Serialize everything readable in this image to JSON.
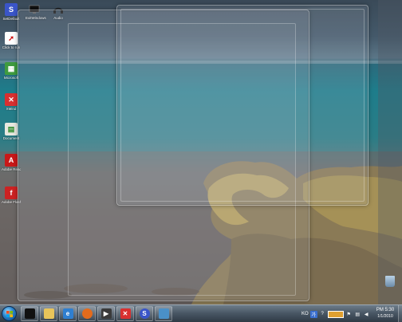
{
  "desktop": {
    "top_icons": [
      {
        "label": "ExitWindows",
        "icon": "monitor-icon"
      },
      {
        "label": "Audio",
        "icon": "headphones-icon"
      }
    ],
    "left_icons": [
      {
        "label": "SetDefault",
        "icon": "swirl-app-icon",
        "color": "#3a55c8"
      },
      {
        "label": "Click to run",
        "icon": "cursor-app-icon",
        "color": "#ffffff"
      },
      {
        "label": "Microsoft",
        "icon": "sheet-app-icon",
        "color": "#3f9b3f"
      },
      {
        "label": "XMind",
        "icon": "x-app-icon",
        "color": "#d83030"
      },
      {
        "label": "Document",
        "icon": "document-icon",
        "color": "#e8e8e0"
      },
      {
        "label": "Adobe Reader",
        "icon": "pdf-icon",
        "color": "#c81818"
      },
      {
        "label": "Adobe Flash",
        "icon": "flash-icon",
        "color": "#cc2222"
      }
    ],
    "recycle_bin": {
      "label": "",
      "icon": "recycle-bin-icon"
    }
  },
  "taskbar": {
    "start": {
      "icon": "windows-start-orb-icon"
    },
    "buttons": [
      {
        "icon": "cmd-window-icon",
        "color": "#111111",
        "glyph": ""
      },
      {
        "icon": "explorer-folder-icon",
        "color": "#e8c45a",
        "glyph": ""
      },
      {
        "icon": "internet-explorer-icon",
        "color": "#2f7fd0",
        "glyph": "e"
      },
      {
        "icon": "firefox-icon",
        "color": "#e36b1c",
        "glyph": ""
      },
      {
        "icon": "media-player-icon",
        "color": "#3a3a3a",
        "glyph": "▶"
      },
      {
        "icon": "xmind-icon",
        "color": "#d83030",
        "glyph": "✕"
      },
      {
        "icon": "setdefault-app-icon",
        "color": "#3a55c8",
        "glyph": "S"
      },
      {
        "icon": "remote-desktop-icon",
        "color": "#4a90c8",
        "glyph": ""
      }
    ],
    "tray": {
      "lang": "KO",
      "icons": [
        "ime-icon",
        "help-icon",
        "network-monitor-icon",
        "flag-icon",
        "network-icon",
        "volume-icon"
      ]
    },
    "clock": {
      "time": "PM 5:30",
      "date": "1/1/2010"
    }
  }
}
